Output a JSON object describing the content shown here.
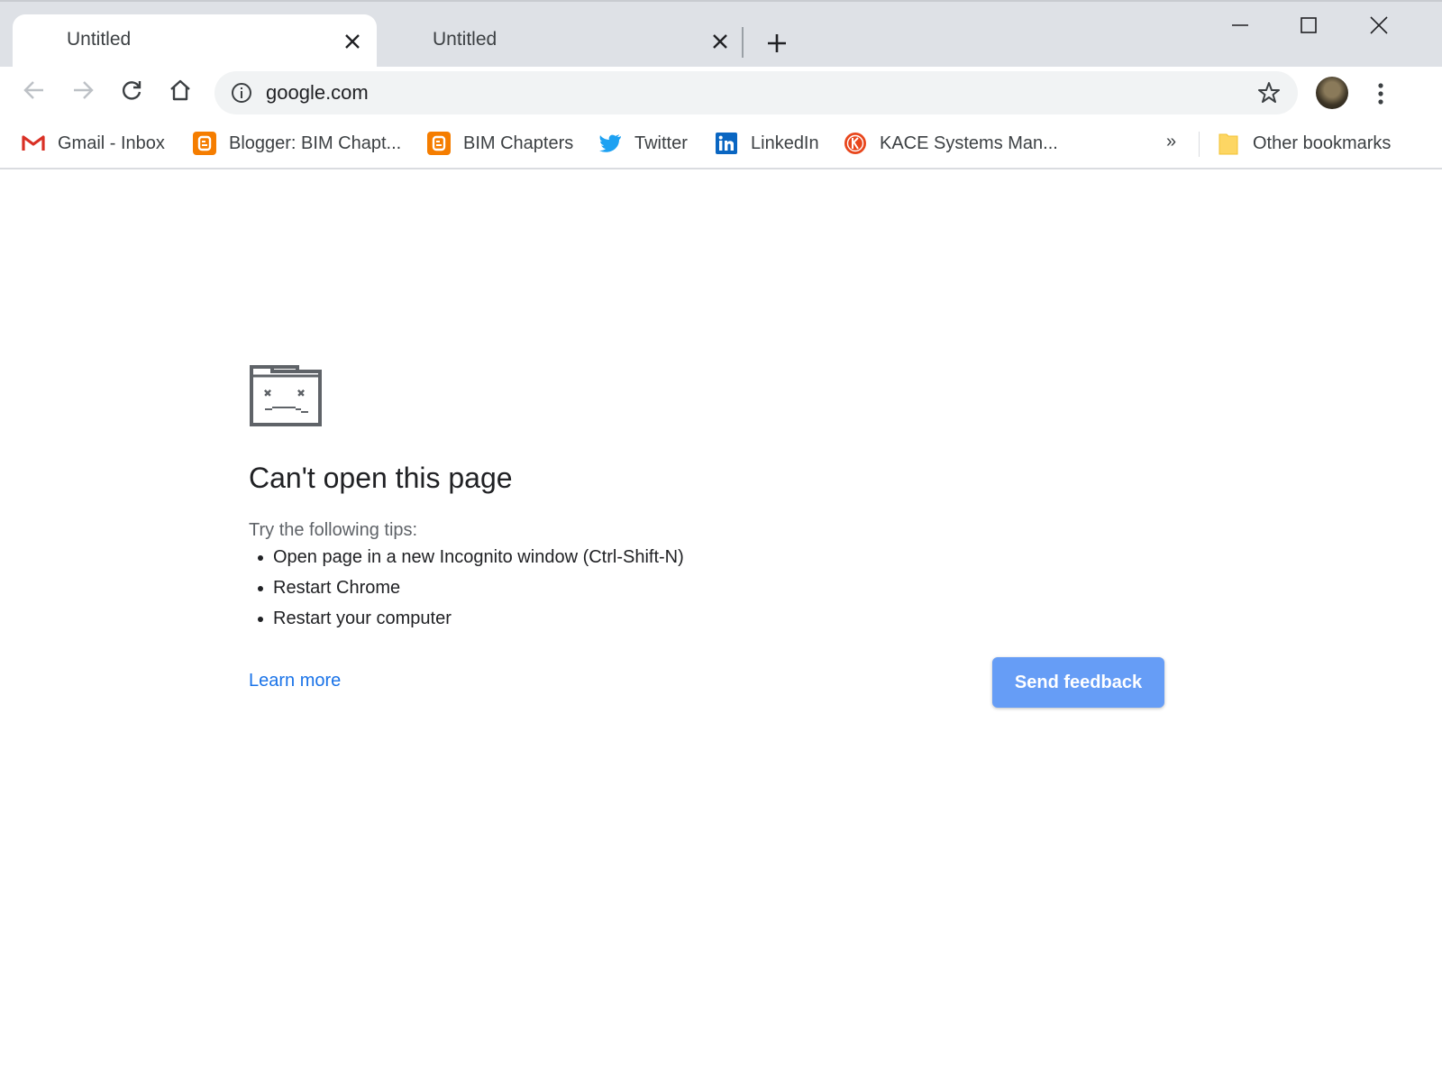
{
  "tabs": [
    {
      "title": "Untitled",
      "active": true
    },
    {
      "title": "Untitled",
      "active": false
    }
  ],
  "omnibox": {
    "url": "google.com"
  },
  "bookmarks": [
    {
      "label": "Gmail - Inbox",
      "icon": "gmail-icon"
    },
    {
      "label": "Blogger: BIM Chapt...",
      "icon": "blogger-icon"
    },
    {
      "label": "BIM Chapters",
      "icon": "blogger-icon"
    },
    {
      "label": "Twitter",
      "icon": "twitter-icon"
    },
    {
      "label": "LinkedIn",
      "icon": "linkedin-icon"
    },
    {
      "label": "KACE Systems Man...",
      "icon": "kace-icon"
    }
  ],
  "bookmarks_overflow": "»",
  "other_bookmarks": "Other bookmarks",
  "error": {
    "title": "Can't open this page",
    "tips_heading": "Try the following tips:",
    "tips": [
      "Open page in a new Incognito window (Ctrl-Shift-N)",
      "Restart Chrome",
      "Restart your computer"
    ],
    "learn_more": "Learn more",
    "send_feedback": "Send feedback"
  },
  "colors": {
    "tabstrip_bg": "#dee1e6",
    "link": "#1a73e8",
    "button_bg": "#669df6"
  }
}
